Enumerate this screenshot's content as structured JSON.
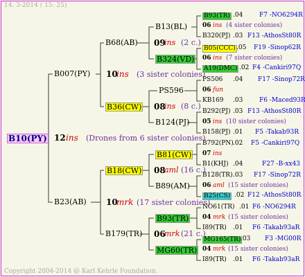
{
  "colors": {
    "line": "#3a3a3a",
    "frame": "#cc33cc",
    "hl_yellow": "#ffff00",
    "hl_green": "#33cc33",
    "hl_cyan": "#33cccc",
    "hl_pink": "#ffccff",
    "text_red": "#cc0000",
    "text_purple": "#6b2fa0",
    "text_blue": "#0000cc"
  },
  "header": {
    "date": "14. 3-2014 ( 15: 25)"
  },
  "footer": {
    "copyright": "Copyright 2004-2014 @ Karl Kehrle Foundation."
  },
  "root": {
    "id": "B10(PY)",
    "year": "12",
    "race": "ins",
    "note": "(Drones from 6 sister colonies)"
  },
  "father": {
    "id": "B007(PY)",
    "year": "10",
    "race": "ins",
    "note": "(3 sister colonies)"
  },
  "mother": {
    "id": "B23(AB)",
    "year": "10",
    "race": "mrk",
    "note": "(17 sister colonies)"
  },
  "ff": {
    "id": "B68(AB)",
    "year": "09",
    "race": "ins",
    "note": "(2 c.)"
  },
  "fm": {
    "id": "B36(CW)",
    "year": "08",
    "race": "ins",
    "note": "(8 c.)"
  },
  "mf": {
    "id": "B18(CW)",
    "year": "08",
    "race": "aml",
    "note": "(16 c.)"
  },
  "mm": {
    "id": "B179(TR)",
    "year": "06",
    "race": "mrk",
    "note": "(21 c.)"
  },
  "fff": {
    "id": "B13(BL)"
  },
  "ffm": {
    "id": "B324(VD)"
  },
  "fmf": {
    "id": "PS596"
  },
  "fmm": {
    "id": "B124(PJ)"
  },
  "mff": {
    "id": "B81(CW)"
  },
  "mfm": {
    "id": "B89(AM)"
  },
  "mmf": {
    "id": "B93(TR)"
  },
  "mmm": {
    "id": "MG60(TR)"
  },
  "g4": [
    {
      "id": "B93(TR)",
      "val": ".04",
      "ref": "F7 -NO6294R"
    },
    {
      "year": "06",
      "race": "ins",
      "note": "(4 sister colonies)"
    },
    {
      "id": "B320(PJ)",
      "val": ".03",
      "ref": "F13 -AthosSt80R"
    },
    {
      "id": "B05(CCC)",
      "val": ".05",
      "ref": "F19 -Sinop62R"
    },
    {
      "year": "06",
      "race": "ins",
      "note": "(7 sister colonies)"
    },
    {
      "id": "A19(DMC)",
      "val": ".02",
      "ref": "F4 -Cankiri97Q"
    },
    {
      "id": "PS506",
      "val": ".04",
      "ref": "F17 -Sinop72R"
    },
    {
      "year": "06",
      "race": "fun",
      "note": ""
    },
    {
      "id": "KB169",
      "val": ".03",
      "ref": "F6 -Maced93R"
    },
    {
      "id": "B292(PJ)",
      "val": ".03",
      "ref": "F13 -AthosSt80R"
    },
    {
      "year": "05",
      "race": "ins",
      "note": "(10 sister colonies)"
    },
    {
      "id": "B158(PJ)",
      "val": ".01",
      "ref": "F5 -Takab93R"
    },
    {
      "id": "B792(PN)",
      "val": ".02",
      "ref": "F5 -Cankiri97Q"
    },
    {
      "year": "07",
      "race": "ins",
      "note": ""
    },
    {
      "id": "B1(KHJ)",
      "val": ".04",
      "ref": "F27 -B-xx43"
    },
    {
      "id": "B128(TR)",
      "val": ".03",
      "ref": "F17 -Sinop72R"
    },
    {
      "year": "06",
      "race": "aml",
      "note": "(15 sister colonies)"
    },
    {
      "id": "B25(CS)",
      "val": ".02",
      "ref": "F12 -AthosSt80R"
    },
    {
      "id": "NO61(TR)",
      "val": ".01",
      "ref": "F6 -NO6294R"
    },
    {
      "year": "04",
      "race": "mrk",
      "note": "(15 sister colonies)"
    },
    {
      "id": "I89(TR)",
      "val": ".01",
      "ref": "F6 -Takab93aR"
    },
    {
      "id": "MG165(TR)",
      "val": ".03",
      "ref": "F3 -MG00R"
    },
    {
      "year": "04",
      "race": "mrk",
      "note": "(15 sister colonies)"
    },
    {
      "id": "I89(TR)",
      "val": ".01",
      "ref": "F6 -Takab93aR"
    }
  ]
}
